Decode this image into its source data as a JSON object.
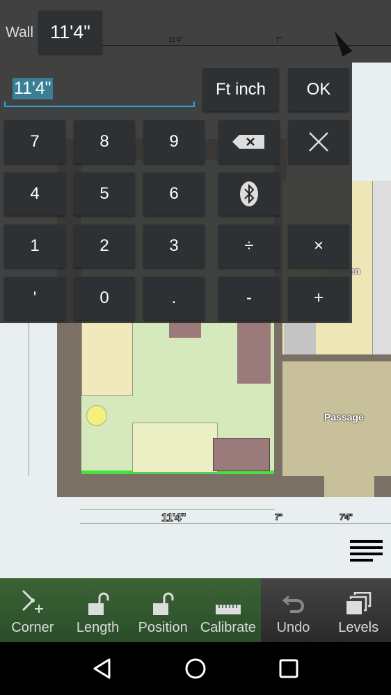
{
  "header": {
    "field_label": "Wall",
    "field_value": "11'4\""
  },
  "input": {
    "value": "11'4\"",
    "unit_button": "Ft inch",
    "ok_button": "OK"
  },
  "keypad": {
    "rows": [
      [
        "7",
        "8",
        "9",
        "backspace",
        "clear"
      ],
      [
        "4",
        "5",
        "6",
        "bluetooth",
        "÷"
      ],
      [
        "1",
        "2",
        "3",
        "÷",
        "×"
      ],
      [
        "'",
        "0",
        ".",
        "-",
        "+"
      ]
    ],
    "keys": {
      "k7": "7",
      "k8": "8",
      "k9": "9",
      "k4": "4",
      "k5": "5",
      "k6": "6",
      "k1": "1",
      "k2": "2",
      "k3": "3",
      "feet": "'",
      "k0": "0",
      "dot": ".",
      "divide": "÷",
      "multiply": "×",
      "minus": "-",
      "plus": "+"
    }
  },
  "plan": {
    "kitchen": "Kitchen",
    "passage": "Passage",
    "dim_bottom_main": "11'4\"",
    "dim_bottom_small": "7\"",
    "dim_bottom_right": "7'4\"",
    "dim_top_main": "11'4\"",
    "dim_top_small": "7\""
  },
  "toolbar": {
    "items": [
      {
        "label": "Corner",
        "icon": "corner-add-icon"
      },
      {
        "label": "Length",
        "icon": "unlock-icon"
      },
      {
        "label": "Position",
        "icon": "unlock-icon"
      },
      {
        "label": "Calibrate",
        "icon": "ruler-icon"
      },
      {
        "label": "Undo",
        "icon": "undo-icon"
      },
      {
        "label": "Levels",
        "icon": "layers-icon"
      }
    ]
  },
  "colors": {
    "toolbar_green": "#2f5a2e",
    "toolbar_dark": "#353535",
    "accent": "#2aa3d6",
    "selected_wall": "#44e33c",
    "room_floor": "#d5e9bd"
  }
}
